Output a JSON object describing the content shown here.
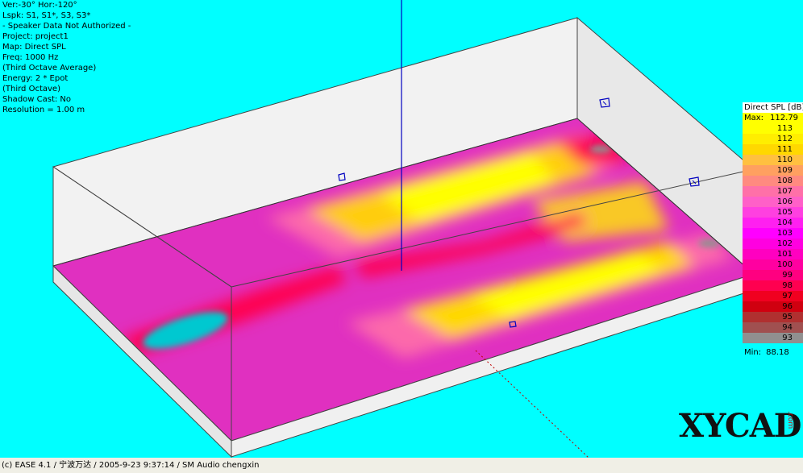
{
  "info": [
    "Ver:-30°   Hor:-120°",
    "Lspk: S1, S1*, S3, S3*",
    "- Speaker Data Not Authorized -",
    "Project: project1",
    "Map: Direct SPL",
    "Freq: 1000 Hz",
    "(Third Octave Average)",
    "Energy: 2 * Epot",
    "(Third Octave)",
    "Shadow Cast: No",
    "Resolution =   1.00 m"
  ],
  "legend": {
    "title": "Direct SPL [dB]",
    "max_label": "Max:",
    "max_value": "112.79",
    "min_label": "Min:",
    "min_value": "88.18",
    "rows": [
      {
        "label": "113",
        "color": "#ffff00"
      },
      {
        "label": "112",
        "color": "#ffee00"
      },
      {
        "label": "111",
        "color": "#ffd800"
      },
      {
        "label": "110",
        "color": "#ffc040"
      },
      {
        "label": "109",
        "color": "#ffa060"
      },
      {
        "label": "108",
        "color": "#ff8a80"
      },
      {
        "label": "107",
        "color": "#ff70a8"
      },
      {
        "label": "106",
        "color": "#ff60c8"
      },
      {
        "label": "105",
        "color": "#ff40e0"
      },
      {
        "label": "104",
        "color": "#ff20f0"
      },
      {
        "label": "103",
        "color": "#ff00ff"
      },
      {
        "label": "102",
        "color": "#ff00e0"
      },
      {
        "label": "101",
        "color": "#ff00c0"
      },
      {
        "label": "100",
        "color": "#ff00a0"
      },
      {
        "label": "99",
        "color": "#ff0080"
      },
      {
        "label": "98",
        "color": "#ff0050"
      },
      {
        "label": "97",
        "color": "#f00020"
      },
      {
        "label": "96",
        "color": "#d00010"
      },
      {
        "label": "95",
        "color": "#b03030"
      },
      {
        "label": "94",
        "color": "#a05050"
      },
      {
        "label": "93",
        "color": "#909090"
      }
    ]
  },
  "colors": {
    "background": "#00ffff",
    "floor_base": "#e030c0",
    "hot": "#ffff00",
    "warm": "#ff70a8",
    "cold": "#00c8d0",
    "edge": "#d00030"
  },
  "statusbar": "(c) EASE 4.1  / 宁波万达  / 2005-9-23 9:37:14 / SM Audio chengxin",
  "logo": {
    "text": "XYCAD",
    "sub": ".com"
  },
  "icons": [
    "speaker-icon",
    "speaker-icon",
    "speaker-icon",
    "speaker-icon"
  ]
}
